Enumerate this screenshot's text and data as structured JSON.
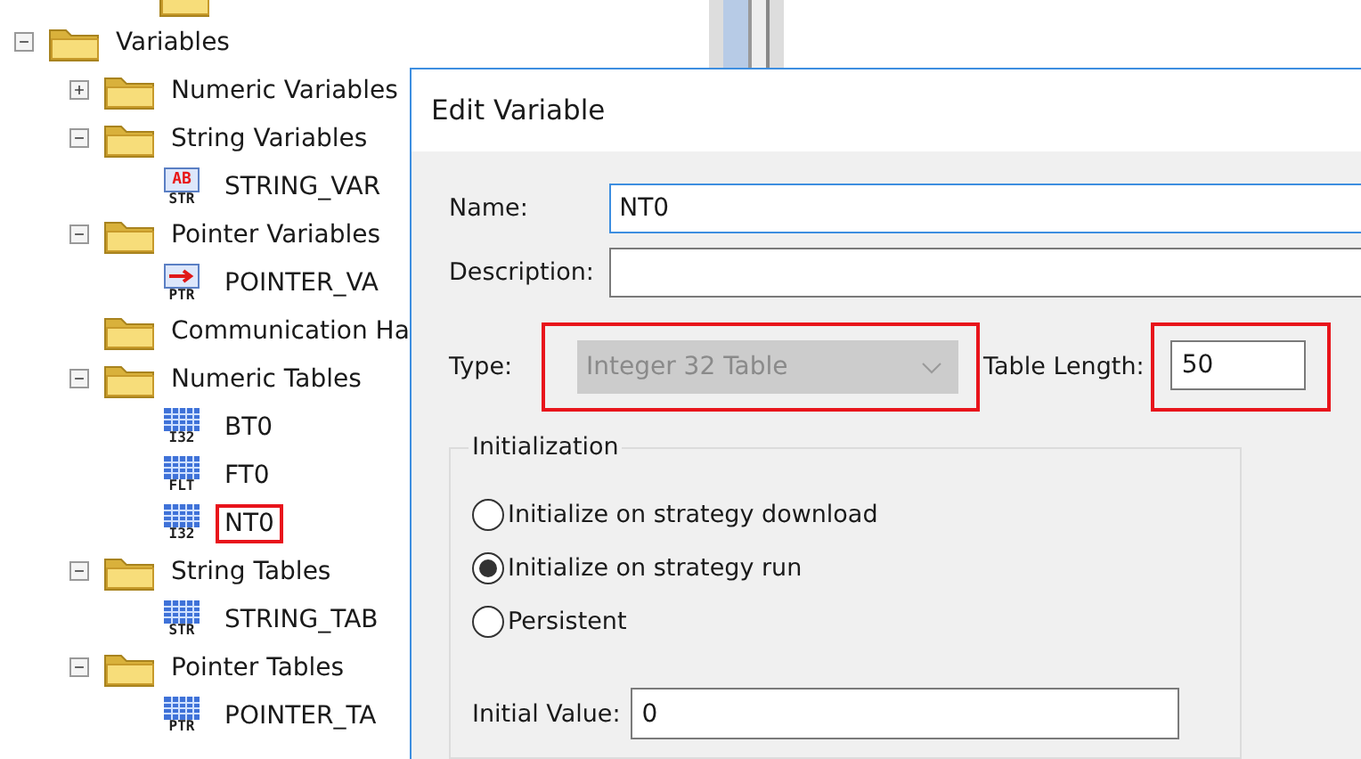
{
  "tree": [
    {
      "kind": "stub"
    },
    {
      "kind": "folder",
      "label": "Variables",
      "expanded": true,
      "highlighted": false,
      "children": [
        {
          "kind": "folder",
          "label": "Numeric Variables",
          "expanded": false,
          "highlighted": false
        },
        {
          "kind": "folder",
          "label": "String Variables",
          "expanded": true,
          "highlighted": false,
          "children": [
            {
              "kind": "string_var",
              "label": "STRING_VAR",
              "icon_text": "AB",
              "icon_label": "STR",
              "highlighted": false
            }
          ]
        },
        {
          "kind": "folder",
          "label": "Pointer Variables",
          "expanded": true,
          "highlighted": false,
          "children": [
            {
              "kind": "pointer_var",
              "label": "POINTER_VA",
              "icon_label": "PTR",
              "highlighted": false
            }
          ]
        },
        {
          "kind": "folder",
          "label": "Communication Ha",
          "highlighted": false
        },
        {
          "kind": "folder",
          "label": "Numeric Tables",
          "expanded": true,
          "highlighted": false,
          "children": [
            {
              "kind": "table",
              "label": "BT0",
              "icon_label": "I32",
              "highlighted": false
            },
            {
              "kind": "table",
              "label": "FT0",
              "icon_label": "FLT",
              "highlighted": false
            },
            {
              "kind": "table",
              "label": "NT0",
              "icon_label": "I32",
              "highlighted": true
            }
          ]
        },
        {
          "kind": "folder",
          "label": "String Tables",
          "expanded": true,
          "highlighted": false,
          "children": [
            {
              "kind": "table",
              "label": "STRING_TAB",
              "icon_label": "STR",
              "highlighted": false
            }
          ]
        },
        {
          "kind": "folder",
          "label": "Pointer Tables",
          "expanded": true,
          "highlighted": false,
          "children": [
            {
              "kind": "table",
              "label": "POINTER_TA",
              "icon_label": "PTR",
              "highlighted": false
            }
          ]
        }
      ]
    }
  ],
  "dialog": {
    "title": "Edit Variable",
    "name": {
      "label": "Name:",
      "value": "NT0",
      "focused": true
    },
    "description": {
      "label": "Description:"
    },
    "type": {
      "label": "Type:",
      "value": "Integer 32 Table",
      "disabled": true,
      "highlighted": true
    },
    "table_length": {
      "label": "Table Length:",
      "value": "50",
      "highlighted": true
    },
    "initialization": {
      "title": "Initialization",
      "options": [
        {
          "label": "Initialize on strategy download",
          "selected": false
        },
        {
          "label": "Initialize on strategy run",
          "selected": true
        },
        {
          "label": "Persistent",
          "selected": false
        }
      ],
      "initial_value": {
        "label": "Initial Value:",
        "value": "0"
      }
    }
  }
}
